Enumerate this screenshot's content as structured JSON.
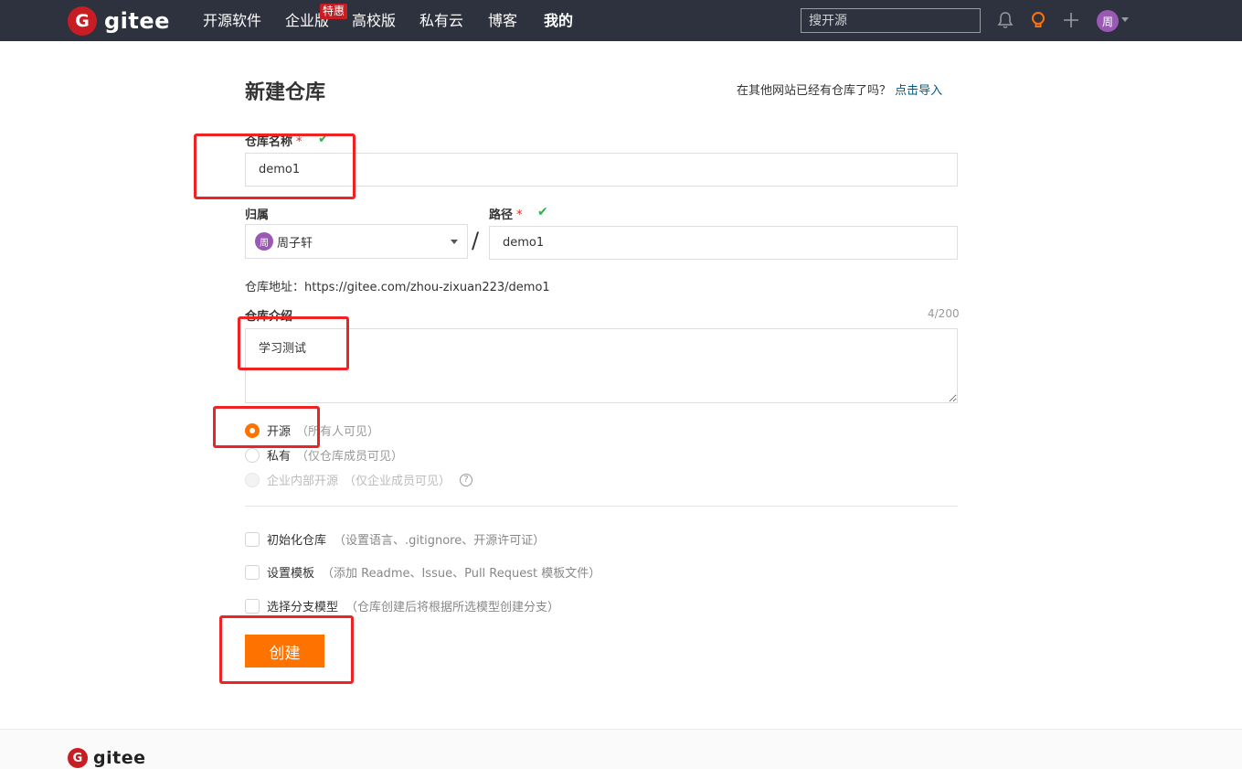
{
  "brand": {
    "logo_letter": "G",
    "name": "gitee",
    "color": "#c71d23"
  },
  "nav": {
    "links": [
      "开源软件",
      "企业版",
      "高校版",
      "私有云",
      "博客",
      "我的"
    ],
    "promo_badge": "特惠",
    "search_placeholder": "搜开源",
    "avatar_initial": "周"
  },
  "page": {
    "title": "新建仓库",
    "import_prompt": "在其他网站已经有仓库了吗？",
    "import_link": "点击导入"
  },
  "form": {
    "repo_name_label": "仓库名称",
    "repo_name_value": "demo1",
    "owner_label": "归属",
    "owner_avatar_initial": "周",
    "owner_name": "周子轩",
    "path_label": "路径",
    "path_value": "demo1",
    "required_mark": "*",
    "check_mark": "✔",
    "slash": "/",
    "repo_address": "仓库地址：https://gitee.com/zhou-zixuan223/demo1",
    "intro_label": "仓库介绍",
    "intro_counter": "4/200",
    "intro_value": "学习测试",
    "visibility": [
      {
        "label": "开源",
        "hint": "（所有人可见）",
        "selected": true
      },
      {
        "label": "私有",
        "hint": "（仅仓库成员可见）",
        "selected": false
      },
      {
        "label": "企业内部开源",
        "hint": "（仅企业成员可见）",
        "selected": false,
        "disabled": true
      }
    ],
    "help_icon": "?",
    "options": [
      {
        "label": "初始化仓库",
        "hint": "（设置语言、.gitignore、开源许可证）"
      },
      {
        "label": "设置模板",
        "hint": "（添加 Readme、Issue、Pull Request 模板文件）"
      },
      {
        "label": "选择分支模型",
        "hint": "（仓库创建后将根据所选模型创建分支）"
      }
    ],
    "submit_label": "创建"
  },
  "colors": {
    "accent": "#fe7300",
    "nav_bg": "#2e323e",
    "highlight": "#ee2323",
    "success": "#21ba45"
  }
}
